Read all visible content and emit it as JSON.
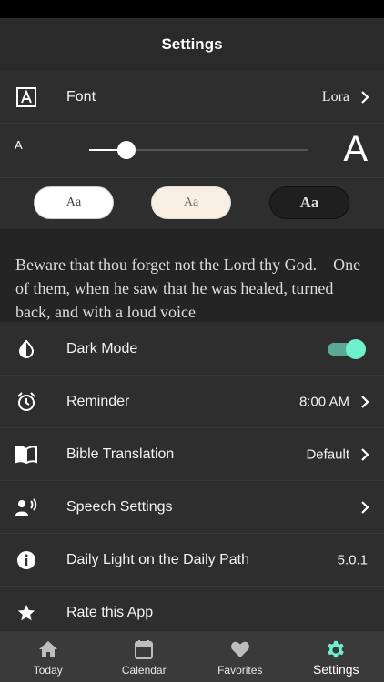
{
  "header": {
    "title": "Settings"
  },
  "font_row": {
    "label": "Font",
    "value": "Lora",
    "icon": "font-icon"
  },
  "size": {
    "small_label": "A",
    "large_label": "A",
    "level": 0.17
  },
  "themes": [
    {
      "label": "Aa",
      "name": "light"
    },
    {
      "label": "Aa",
      "name": "sepia"
    },
    {
      "label": "Aa",
      "name": "dark"
    }
  ],
  "preview": {
    "text": "Beware that thou forget not the Lord thy God.—One of them, when he saw that he was healed, turned back, and with a loud voice"
  },
  "settings": {
    "dark_mode": {
      "label": "Dark Mode",
      "enabled": true,
      "icon": "contrast-icon"
    },
    "reminder": {
      "label": "Reminder",
      "value": "8:00 AM",
      "icon": "alarm-clock-icon"
    },
    "translation": {
      "label": "Bible Translation",
      "value": "Default",
      "icon": "book-icon"
    },
    "speech": {
      "label": "Speech Settings",
      "icon": "speaker-person-icon"
    },
    "about": {
      "label": "Daily Light on the Daily Path",
      "value": "5.0.1",
      "icon": "info-icon"
    },
    "rate": {
      "label": "Rate this App",
      "icon": "star-icon"
    }
  },
  "tabs": [
    {
      "label": "Today",
      "icon": "home-icon"
    },
    {
      "label": "Calendar",
      "icon": "calendar-icon"
    },
    {
      "label": "Favorites",
      "icon": "heart-icon"
    },
    {
      "label": "Settings",
      "icon": "gear-icon",
      "active": true
    }
  ],
  "colors": {
    "accent": "#6ff0cf",
    "toggle_track": "#5aa997",
    "background": "#2e2e2e"
  }
}
